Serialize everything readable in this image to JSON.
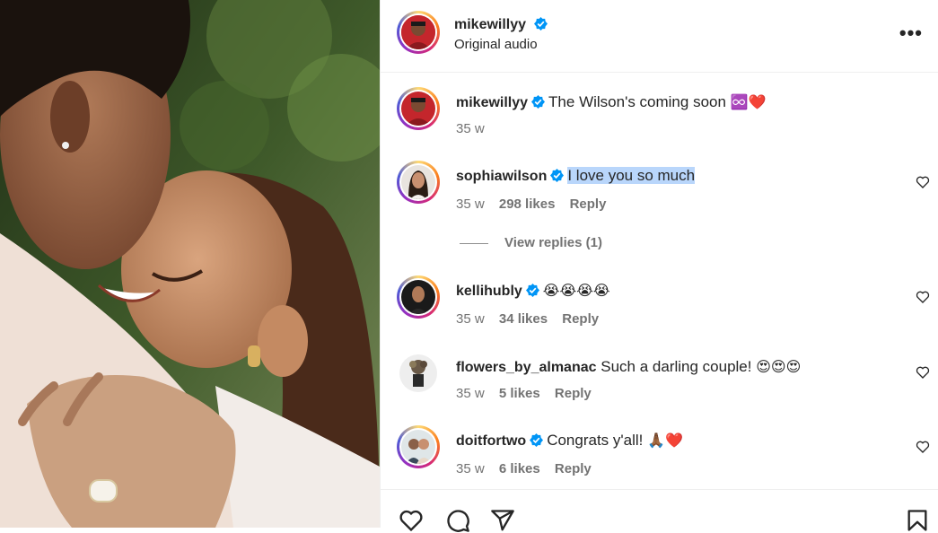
{
  "post": {
    "username": "mikewillyy",
    "subtitle": "Original audio",
    "more_icon": "more-horizontal-icon",
    "more_label": "•••"
  },
  "caption": {
    "username": "mikewillyy",
    "text": "The Wilson's coming soon",
    "emoji": "♾️❤️",
    "time": "35 w"
  },
  "comments": [
    {
      "username": "sophiawilson",
      "verified": true,
      "text": "I love you so much",
      "emoji": "",
      "time": "35 w",
      "likes": "298 likes",
      "reply": "Reply",
      "highlighted": true
    },
    {
      "username": "kellihubly",
      "verified": true,
      "text": "",
      "emoji": "😭😭😭😭",
      "time": "35 w",
      "likes": "34 likes",
      "reply": "Reply"
    },
    {
      "username": "flowers_by_almanac",
      "verified": false,
      "text": "Such a darling couple!",
      "emoji": "😍😍😍",
      "time": "35 w",
      "likes": "5 likes",
      "reply": "Reply"
    },
    {
      "username": "doitfortwo",
      "verified": true,
      "text": "Congrats y'all!",
      "emoji": "🙏🏾❤️",
      "time": "35 w",
      "likes": "6 likes",
      "reply": "Reply"
    }
  ],
  "view_replies": "View replies (1)",
  "colors": {
    "verified_blue": "#0095f6",
    "highlight": "#b9d6fb",
    "heart_red": "#ed4956"
  },
  "icons": {
    "like": "heart-outline-icon",
    "comment": "comment-bubble-icon",
    "share": "paper-plane-icon",
    "save": "bookmark-icon"
  }
}
